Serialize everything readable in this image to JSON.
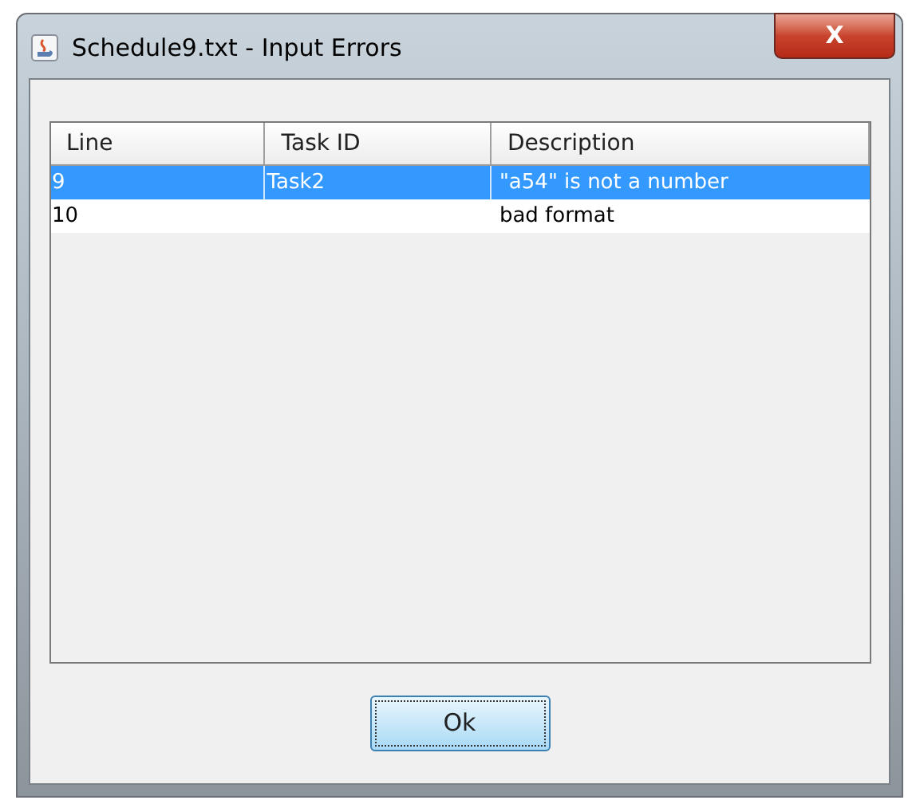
{
  "window": {
    "title": "Schedule9.txt - Input Errors",
    "close_label": "X"
  },
  "table": {
    "columns": [
      "Line",
      "Task ID",
      "Description"
    ],
    "rows": [
      {
        "cells": [
          "9",
          "Task2",
          "\"a54\" is not a number"
        ],
        "selected": true
      },
      {
        "cells": [
          "10",
          "",
          "bad format"
        ],
        "selected": false
      }
    ]
  },
  "buttons": [
    "Ok"
  ]
}
